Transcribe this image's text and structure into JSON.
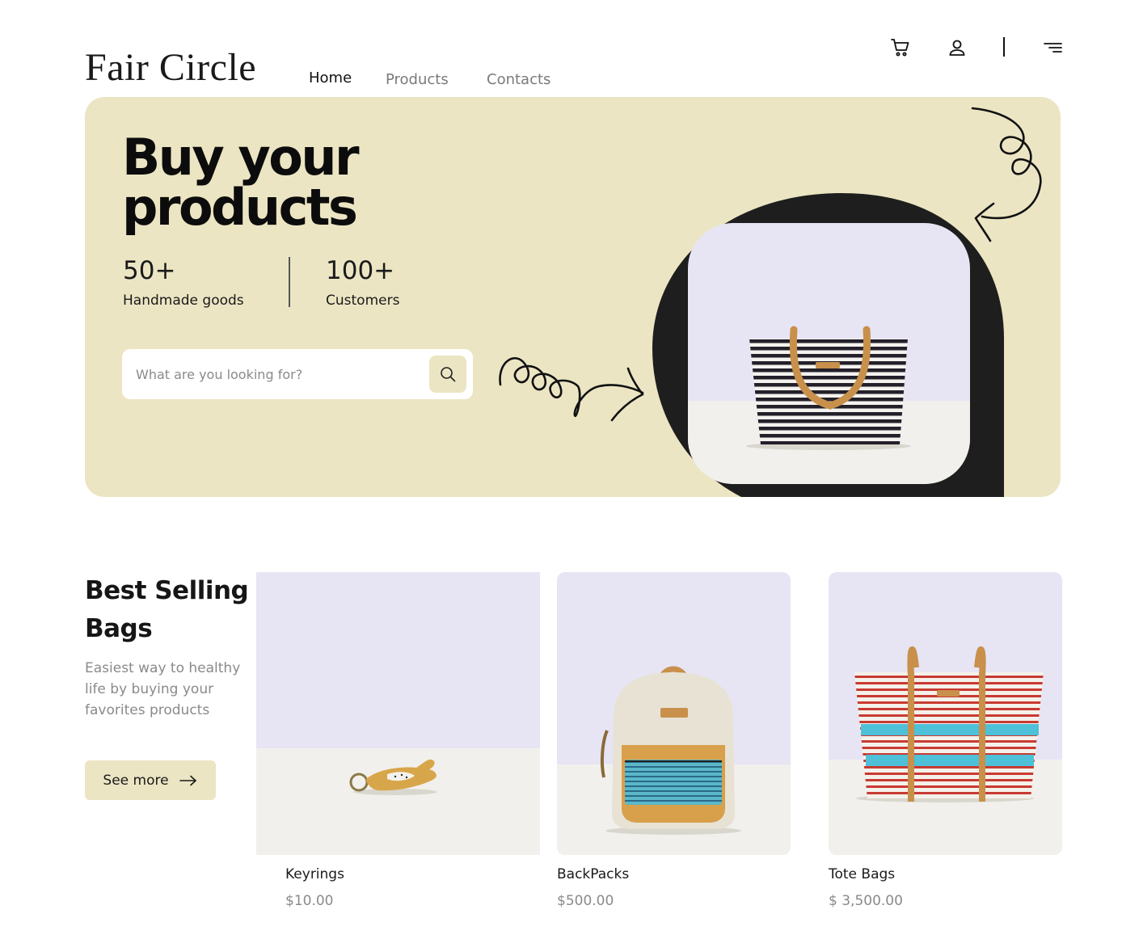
{
  "brand": {
    "logo_text": "Fair Circle"
  },
  "nav": [
    {
      "label": "Home",
      "active": true
    },
    {
      "label": "Products",
      "active": false
    },
    {
      "label": "Contacts",
      "active": false
    }
  ],
  "header_icons": [
    "cart-icon",
    "user-icon",
    "menu-icon"
  ],
  "hero": {
    "title_line1": "Buy your",
    "title_line2": "products",
    "stats": [
      {
        "value": "50+",
        "label": "Handmade goods"
      },
      {
        "value": "100+",
        "label": "Customers"
      }
    ],
    "search": {
      "placeholder": "What are you looking for?",
      "value": ""
    }
  },
  "best_selling": {
    "title": "Best Selling Bags",
    "description": "Easiest way to healthy life by buying your favorites products",
    "button_label": "See more"
  },
  "products": [
    {
      "name": "Keyrings",
      "price": "$10.00"
    },
    {
      "name": "BackPacks",
      "price": "$500.00"
    },
    {
      "name": "Tote Bags",
      "price": "$ 3,500.00"
    }
  ],
  "colors": {
    "hero_bg": "#ebe5c3",
    "blob": "#1e1e1e",
    "text_muted": "#8a8a8a",
    "photo_bg": "#e7e5f4",
    "photo_floor": "#f2f0ec"
  }
}
